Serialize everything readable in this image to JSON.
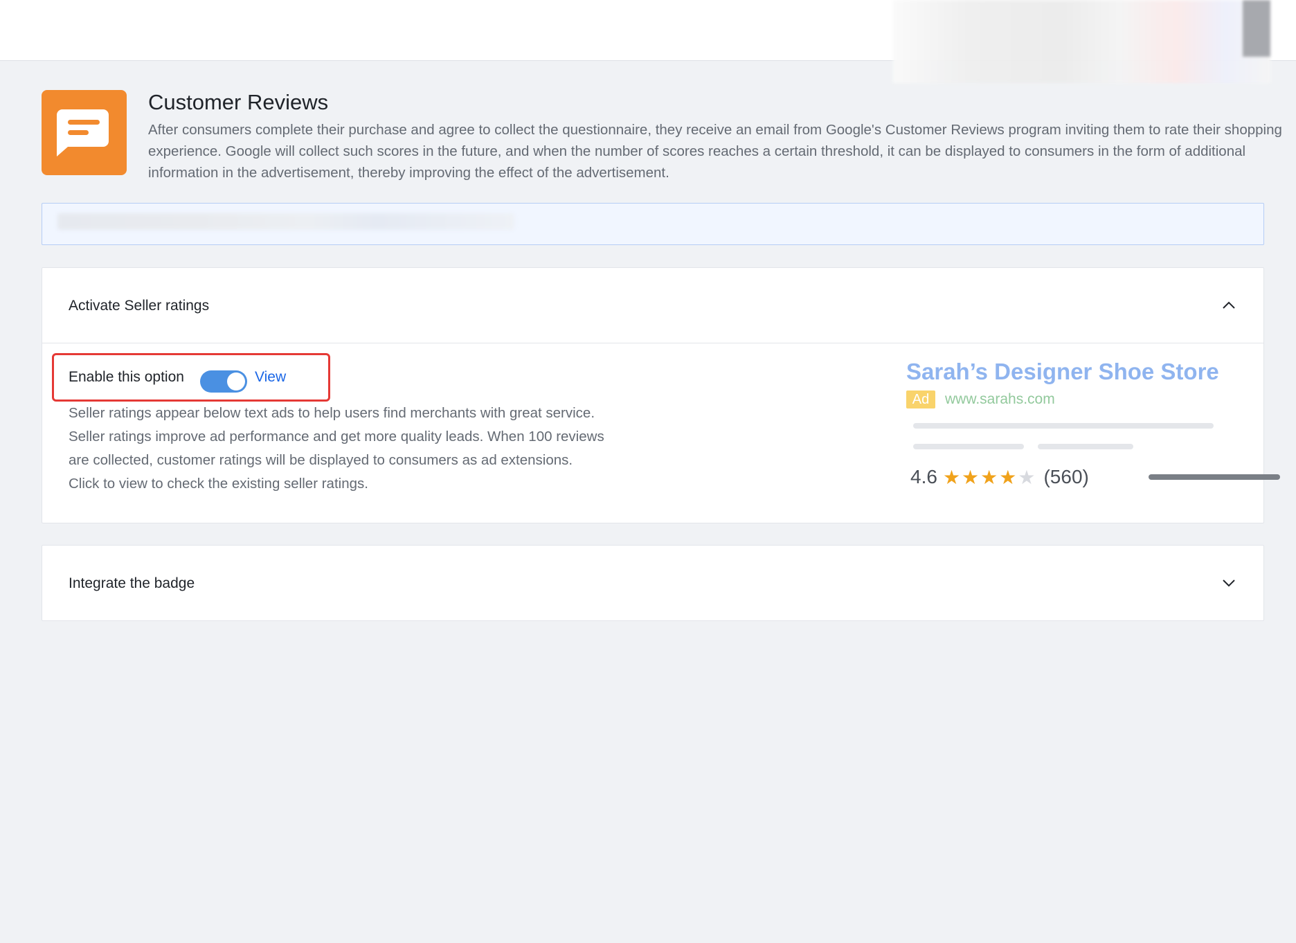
{
  "header": {
    "title": "Customer Reviews",
    "description": "After consumers complete their purchase and agree to collect the questionnaire, they receive an email from Google's Customer Reviews program inviting them to rate their shopping experience. Google will collect such scores in the future, and when the number of scores reaches a certain threshold, it can be displayed to consumers in the form of additional information in the advertisement, thereby improving the effect of the advertisement.",
    "icon": "message-square-icon",
    "icon_bg_color": "#f28a2e"
  },
  "seller_ratings": {
    "title": "Activate Seller ratings",
    "expanded": true,
    "enable_label": "Enable this option",
    "toggle_on": true,
    "toggle_color": "#4a90e2",
    "view_label": "View",
    "info_lines": [
      "Seller ratings appear below text ads to help users find merchants with great service.",
      "Seller ratings improve ad performance and get more quality leads. When 100 reviews",
      "are collected, customer ratings will be displayed to consumers as ad extensions.",
      "Click to view to check the existing seller ratings."
    ],
    "highlight_color": "#e53935"
  },
  "ad_preview": {
    "store_name": "Sarah’s Designer Shoe Store",
    "ad_badge": "Ad",
    "url": "www.sarahs.com",
    "rating_value": "4.6",
    "stars_filled": 4,
    "stars_total": 5,
    "review_count": "(560)"
  },
  "badge_section": {
    "title": "Integrate the badge",
    "expanded": false
  }
}
